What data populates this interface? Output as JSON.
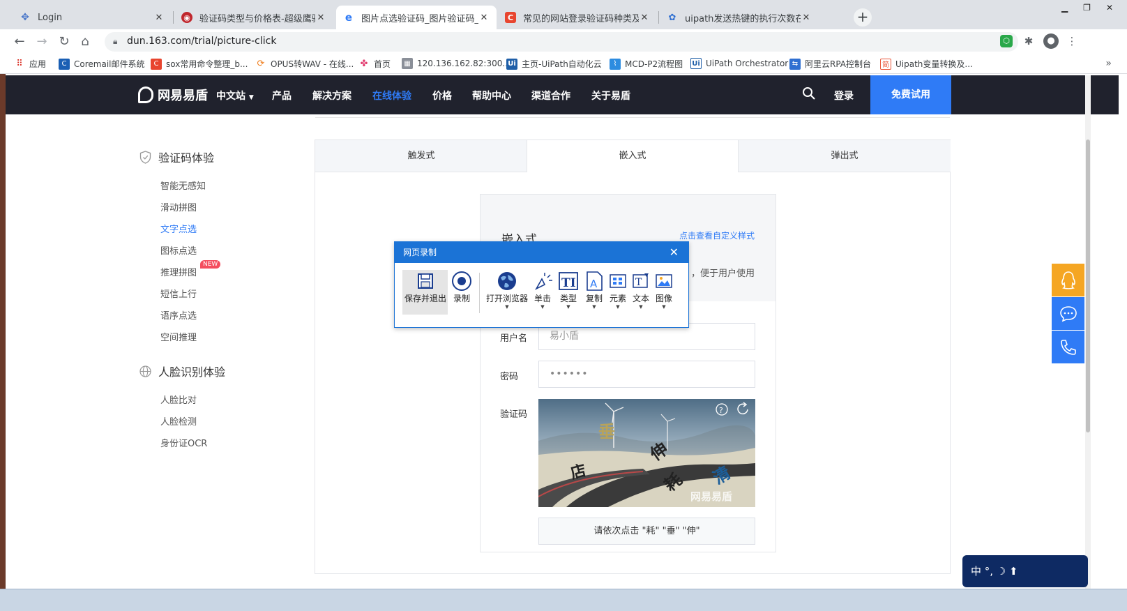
{
  "browser": {
    "tabs": [
      {
        "title": "Login",
        "active": false
      },
      {
        "title": "验证码类型与价格表-超级鹰验证",
        "active": false
      },
      {
        "title": "图片点选验证码_图片验证码_验证",
        "active": true
      },
      {
        "title": "常见的网站登录验证码种类及其",
        "active": false
      },
      {
        "title": "uipath发送热键的执行次数在哪里",
        "active": false
      }
    ],
    "url": "dun.163.com/trial/picture-click",
    "bookmarks": [
      "应用",
      "Coremail邮件系统",
      "sox常用命令整理_b...",
      "OPUS转WAV - 在线...",
      "首页",
      "120.136.162.82:300...",
      "主页-UiPath自动化云",
      "MCD-P2流程图",
      "UiPath Orchestrator",
      "阿里云RPA控制台",
      "Uipath变量转换及..."
    ]
  },
  "site": {
    "logo": "网易易盾",
    "nav": [
      "中文站",
      "产品",
      "解决方案",
      "在线体验",
      "价格",
      "帮助中心",
      "渠道合作",
      "关于易盾"
    ],
    "login": "登录",
    "trial": "免费试用"
  },
  "sidebar": {
    "captcha_heading": "验证码体验",
    "captcha_items": [
      "智能无感知",
      "滑动拼图",
      "文字点选",
      "图标点选",
      "推理拼图",
      "短信上行",
      "语序点选",
      "空间推理"
    ],
    "new_badge": "NEW",
    "face_heading": "人脸识别体验",
    "face_items": [
      "人脸比对",
      "人脸检测",
      "身份证OCR"
    ]
  },
  "panel": {
    "tabs": [
      "触发式",
      "嵌入式",
      "弹出式"
    ],
    "demo_title": "嵌入式",
    "demo_link": "点击查看自定义样式",
    "demo_desc": "，便于用户使用",
    "username_label": "用户名",
    "username_placeholder": "易小盾",
    "password_label": "密码",
    "password_value": "••••••",
    "captcha_label": "验证码",
    "captcha_chars": [
      "垂",
      "店",
      "伸",
      "耗",
      "清"
    ],
    "captcha_watermark": "网易易盾",
    "captcha_tip": "请依次点击 \"耗\" \"垂\" \"伸\""
  },
  "recorder": {
    "title": "网页录制",
    "buttons": [
      "保存并退出",
      "录制",
      "打开浏览器",
      "单击",
      "类型",
      "复制",
      "元素",
      "文本",
      "图像"
    ]
  },
  "ime": {
    "text": "中 °, ☽ ⬆"
  },
  "colors": {
    "accent": "#2f7bf6",
    "header_bg": "#20222d",
    "recorder_blue": "#1b73d6",
    "float_orange": "#f5a623"
  }
}
